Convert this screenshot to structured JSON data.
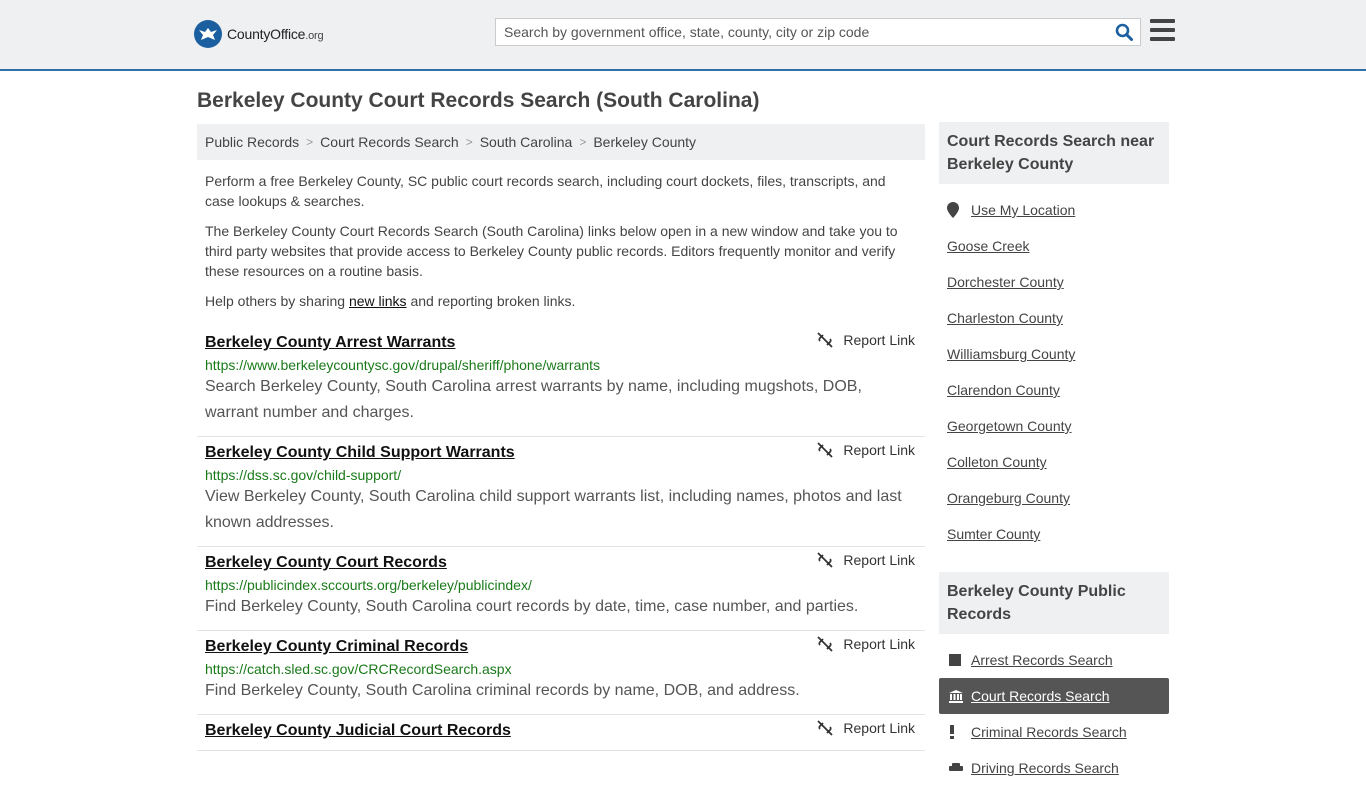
{
  "header": {
    "logo_main": "CountyOffice",
    "logo_tld": ".org",
    "search_placeholder": "Search by government office, state, county, city or zip code"
  },
  "page": {
    "title": "Berkeley County Court Records Search (South Carolina)"
  },
  "breadcrumb": [
    "Public Records",
    "Court Records Search",
    "South Carolina",
    "Berkeley County"
  ],
  "intro": {
    "p1": "Perform a free Berkeley County, SC public court records search, including court dockets, files, transcripts, and case lookups & searches.",
    "p2": "The Berkeley County Court Records Search (South Carolina) links below open in a new window and take you to third party websites that provide access to Berkeley County public records. Editors frequently monitor and verify these resources on a routine basis.",
    "p3_before": "Help others by sharing ",
    "p3_link": "new links",
    "p3_after": " and reporting broken links."
  },
  "report_label": "Report Link",
  "results": [
    {
      "title": "Berkeley County Arrest Warrants",
      "url": "https://www.berkeleycountysc.gov/drupal/sheriff/phone/warrants",
      "desc": "Search Berkeley County, South Carolina arrest warrants by name, including mugshots, DOB, warrant number and charges."
    },
    {
      "title": "Berkeley County Child Support Warrants",
      "url": "https://dss.sc.gov/child-support/",
      "desc": "View Berkeley County, South Carolina child support warrants list, including names, photos and last known addresses."
    },
    {
      "title": "Berkeley County Court Records",
      "url": "https://publicindex.sccourts.org/berkeley/publicindex/",
      "desc": "Find Berkeley County, South Carolina court records by date, time, case number, and parties."
    },
    {
      "title": "Berkeley County Criminal Records",
      "url": "https://catch.sled.sc.gov/CRCRecordSearch.aspx",
      "desc": "Find Berkeley County, South Carolina criminal records by name, DOB, and address."
    },
    {
      "title": "Berkeley County Judicial Court Records",
      "url": "",
      "desc": ""
    }
  ],
  "sidebar": {
    "nearby_heading": "Court Records Search near Berkeley County",
    "use_location": "Use My Location",
    "nearby": [
      "Goose Creek",
      "Dorchester County",
      "Charleston County",
      "Williamsburg County",
      "Clarendon County",
      "Georgetown County",
      "Colleton County",
      "Orangeburg County",
      "Sumter County"
    ],
    "public_heading": "Berkeley County Public Records",
    "public_records": [
      {
        "label": "Arrest Records Search",
        "icon": "square-icon",
        "active": false
      },
      {
        "label": "Court Records Search",
        "icon": "courthouse-icon",
        "active": true
      },
      {
        "label": "Criminal Records Search",
        "icon": "exclamation-icon",
        "active": false
      },
      {
        "label": "Driving Records Search",
        "icon": "car-icon",
        "active": false
      }
    ]
  }
}
